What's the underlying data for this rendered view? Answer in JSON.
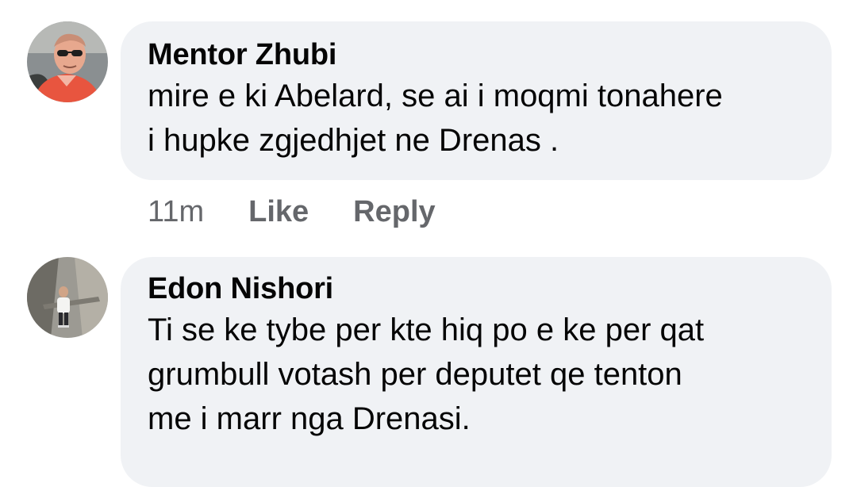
{
  "comments": [
    {
      "author": "Mentor Zhubi",
      "text": "mire e ki Abelard, se ai i moqmi tonahere\ni hupke zgjedhjet ne Drenas .",
      "time": "11m",
      "like_label": "Like",
      "reply_label": "Reply"
    },
    {
      "author": "Edon Nishori",
      "text": "Ti se ke tybe per kte hiq po e ke per qat\ngrumbull votash per deputet qe tenton\nme i marr nga Drenasi."
    }
  ],
  "colors": {
    "bubble": "#f0f2f5",
    "meta_text": "#65676b",
    "primary_text": "#050505"
  }
}
